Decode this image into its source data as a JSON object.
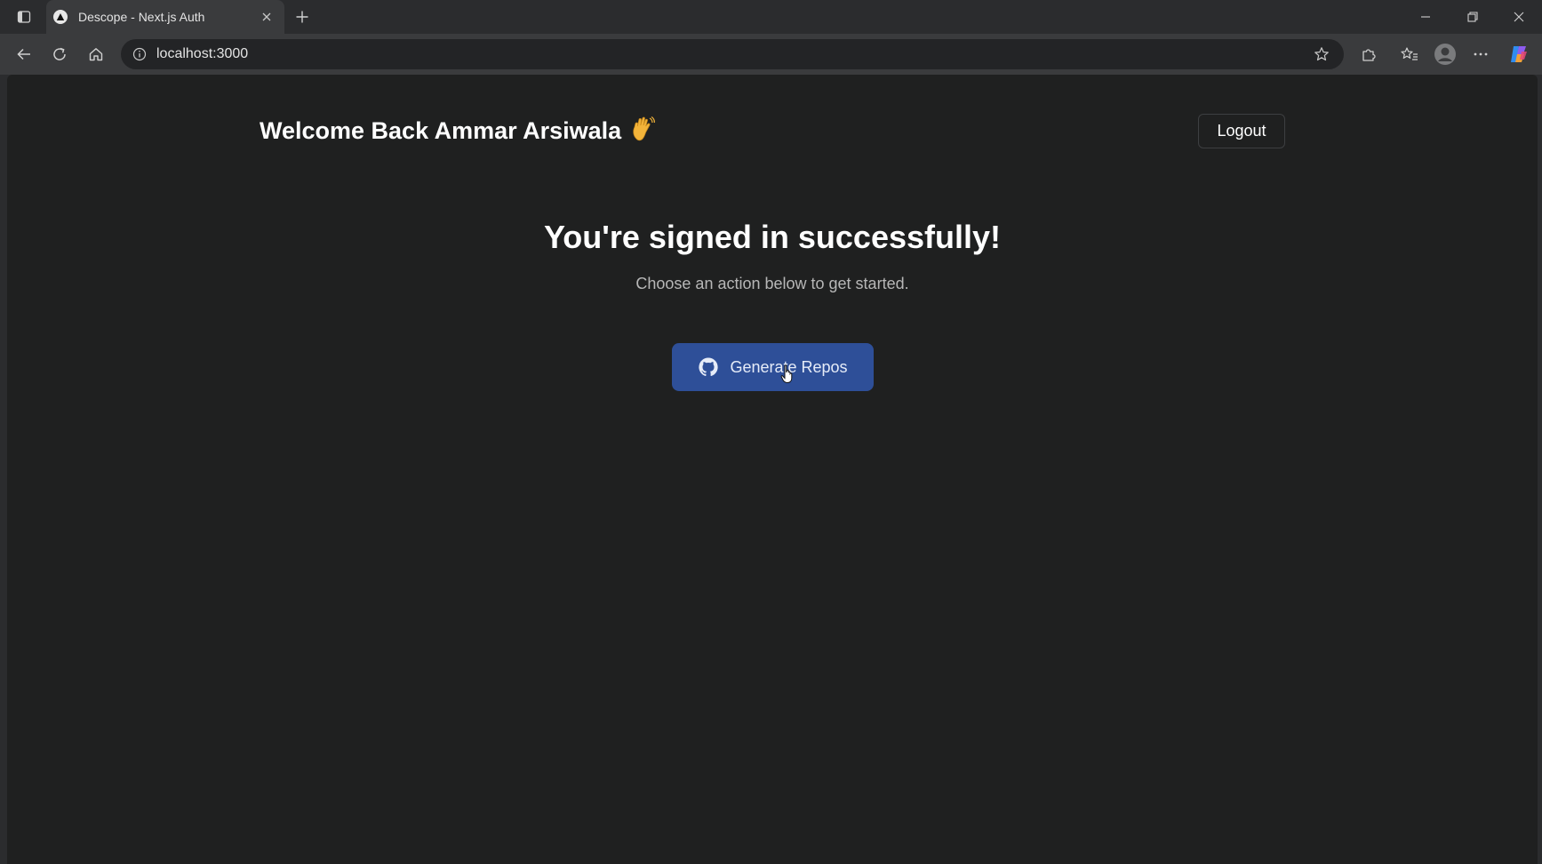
{
  "browser": {
    "tab": {
      "title": "Descope - Next.js Auth",
      "favicon": "triangle-logo-icon"
    },
    "new_tab_icon": "plus-icon",
    "address": {
      "url": "localhost:3000",
      "info_icon": "info-icon",
      "favorite_icon": "star-icon"
    },
    "toolbar_icons": [
      "back-arrow-icon",
      "refresh-icon",
      "home-icon",
      "extensions-icon",
      "favorites-icon",
      "profile-icon",
      "more-icon",
      "copilot-icon"
    ],
    "window_controls": [
      "minimize-icon",
      "restore-icon",
      "close-icon"
    ]
  },
  "page": {
    "welcome": "Welcome Back Ammar Arsiwala",
    "welcome_emoji": "waving-hand-icon",
    "logout_label": "Logout",
    "headline": "You're signed in successfully!",
    "subtext": "Choose an action below to get started.",
    "primary_action": {
      "label": "Generate Repos",
      "icon": "github-icon"
    }
  },
  "colors": {
    "page_bg": "#1f2020",
    "browser_chrome": "#2b2c2e",
    "button_accent": "#2e4f98"
  }
}
